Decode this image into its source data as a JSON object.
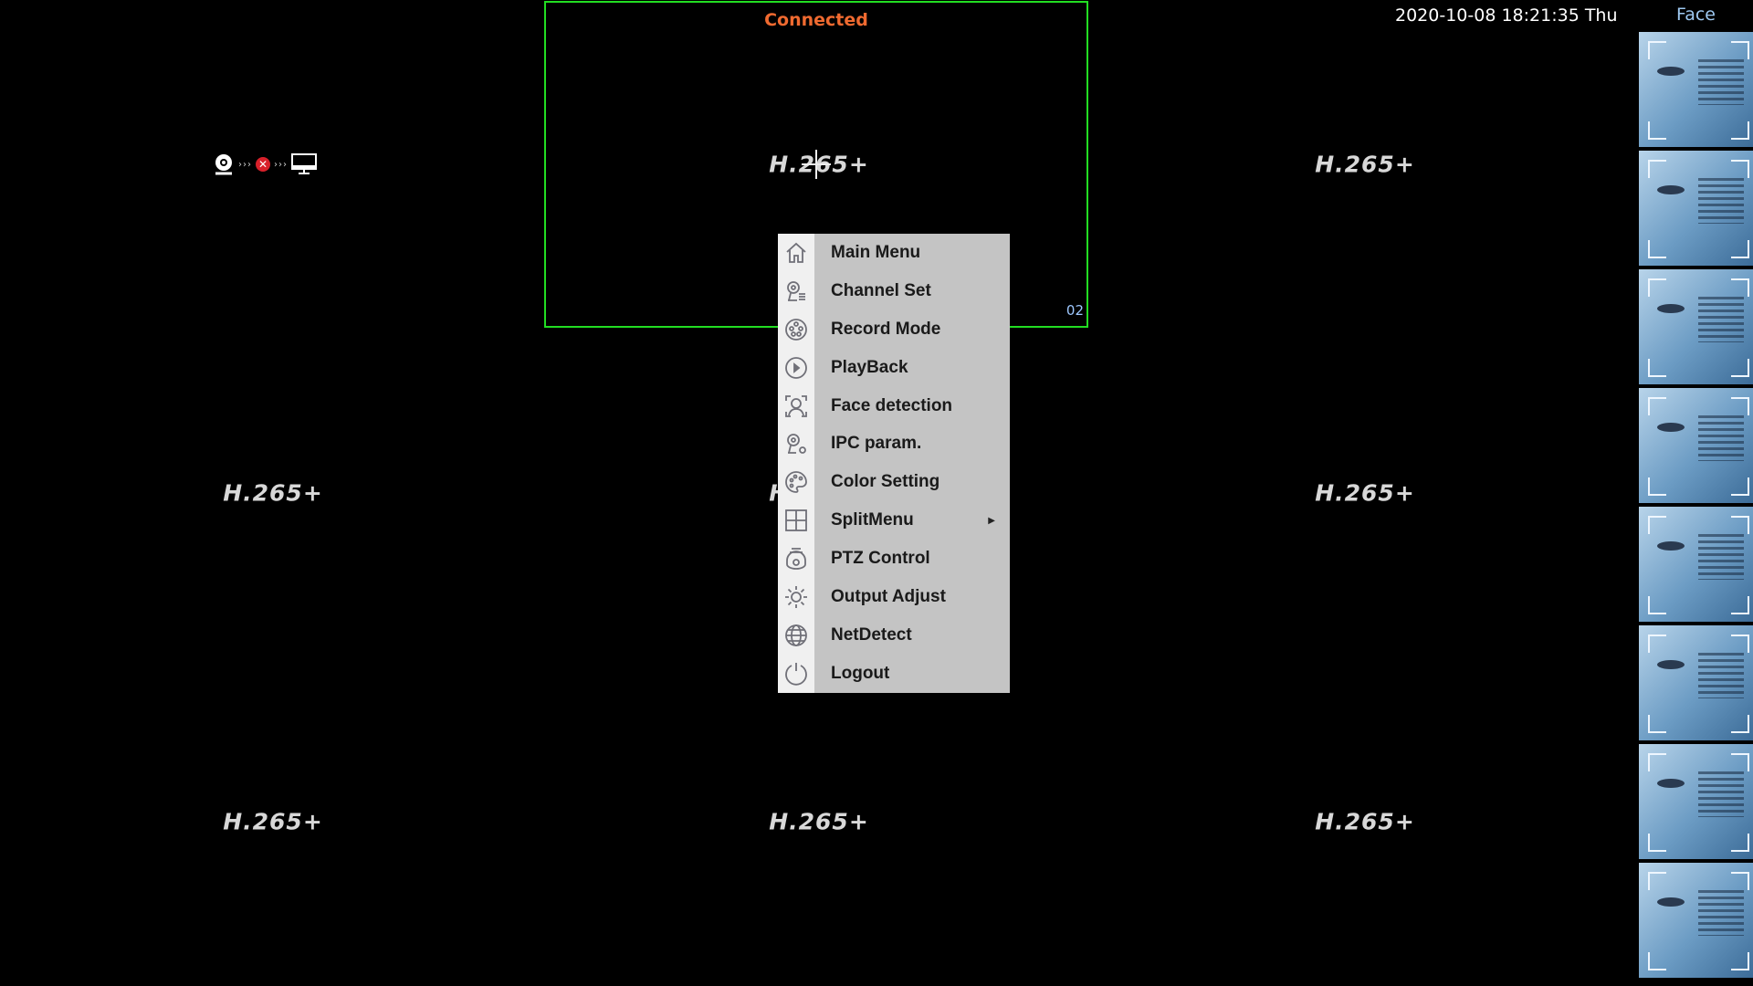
{
  "datetime": "2020-10-08 18:21:35 Thu",
  "face_panel": {
    "title": "Face",
    "thumbnail_count": 8
  },
  "selected_channel": {
    "status": "Connected",
    "number": "02"
  },
  "cells": [
    {
      "codec": "",
      "status_icons": [
        "camera-icon",
        "disconnected-icon",
        "monitor-icon"
      ]
    },
    {
      "codec": "H.265+"
    },
    {
      "codec": "H.265+"
    },
    {
      "codec": "H.265+"
    },
    {
      "codec": "H.265+"
    },
    {
      "codec": "H.265+"
    },
    {
      "codec": "H.265+"
    },
    {
      "codec": "H.265+"
    },
    {
      "codec": "H.265+"
    }
  ],
  "colors": {
    "selection_border": "#22dd22",
    "connected_text": "#f06a30",
    "menu_bg": "#c4c4c4"
  },
  "context_menu": {
    "items": [
      {
        "label": "Main Menu",
        "icon": "home-icon"
      },
      {
        "label": "Channel Set",
        "icon": "camera-list-icon"
      },
      {
        "label": "Record Mode",
        "icon": "film-reel-icon"
      },
      {
        "label": "PlayBack",
        "icon": "play-icon"
      },
      {
        "label": "Face detection",
        "icon": "face-scan-icon"
      },
      {
        "label": "IPC param.",
        "icon": "camera-gear-icon"
      },
      {
        "label": "Color Setting",
        "icon": "palette-icon"
      },
      {
        "label": "SplitMenu",
        "icon": "grid-icon",
        "submenu": true
      },
      {
        "label": "PTZ Control",
        "icon": "ptz-camera-icon"
      },
      {
        "label": "Output Adjust",
        "icon": "brightness-icon"
      },
      {
        "label": "NetDetect",
        "icon": "globe-icon"
      },
      {
        "label": "Logout",
        "icon": "power-icon"
      }
    ]
  }
}
